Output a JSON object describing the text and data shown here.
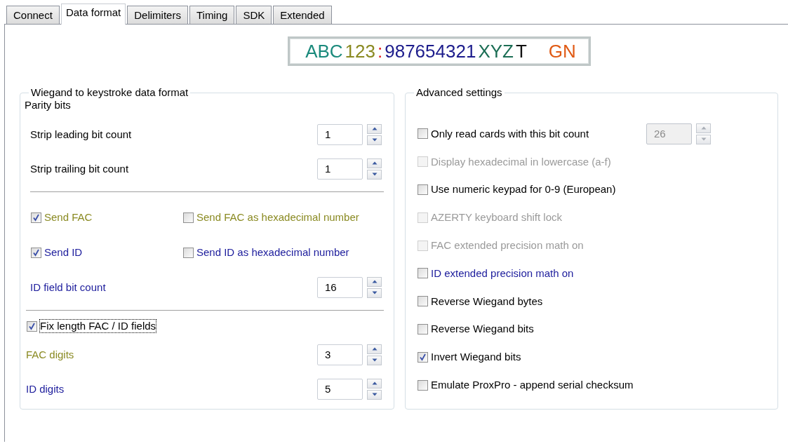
{
  "tabs": [
    {
      "label": "Connect",
      "selected": false
    },
    {
      "label": "Data format",
      "selected": true
    },
    {
      "label": "Delimiters",
      "selected": false
    },
    {
      "label": "Timing",
      "selected": false
    },
    {
      "label": "SDK",
      "selected": false
    },
    {
      "label": "Extended",
      "selected": false
    }
  ],
  "preview": {
    "segments": [
      {
        "text": "ABC",
        "color": "#1b8a7c"
      },
      {
        "text": "123",
        "color": "#8a8a22"
      },
      {
        "text": ":",
        "color": "#e01b1b"
      },
      {
        "text": "987654321",
        "color": "#1c1c8c"
      },
      {
        "text": "XYZ",
        "color": "#1c6e55"
      },
      {
        "text": "T",
        "color": "#111111"
      },
      {
        "text": "GN",
        "color": "#e05a14"
      }
    ]
  },
  "wiegand_group": {
    "title": "Wiegand to keystroke data format",
    "items": [
      {
        "kind": "label",
        "text": "Parity bits"
      },
      {
        "kind": "spin",
        "label": "Strip leading bit count",
        "value": "1",
        "color": "#000000"
      },
      {
        "kind": "spin",
        "label": "Strip trailing bit count",
        "value": "1",
        "color": "#000000"
      },
      {
        "kind": "separator"
      },
      {
        "kind": "pair",
        "checks": [
          {
            "label": "Send FAC",
            "checked": true,
            "disabled": false,
            "color": "#8a8a22"
          },
          {
            "label": "Send FAC as hexadecimal number",
            "checked": false,
            "disabled": false,
            "color": "#8a8a22"
          }
        ]
      },
      {
        "kind": "pair",
        "checks": [
          {
            "label": "Send ID",
            "checked": true,
            "disabled": false,
            "color": "#1c1c9c"
          },
          {
            "label": "Send ID as hexadecimal number",
            "checked": false,
            "disabled": false,
            "color": "#1c1c9c"
          }
        ]
      },
      {
        "kind": "spin",
        "label": "ID field bit count",
        "value": "16",
        "color": "#1c1c9c"
      },
      {
        "kind": "separator"
      },
      {
        "kind": "check",
        "label": "Fix length FAC / ID fields",
        "checked": true,
        "disabled": false,
        "focused": true,
        "color": "#000000"
      },
      {
        "kind": "spin",
        "label": "FAC digits",
        "value": "3",
        "color": "#8a8a22"
      },
      {
        "kind": "spin",
        "label": "ID digits",
        "value": "5",
        "color": "#1c1c9c"
      }
    ]
  },
  "advanced_group": {
    "title": "Advanced settings",
    "items": [
      {
        "kind": "check_spin",
        "label": "Only read cards with this bit count",
        "checked": false,
        "disabled": false,
        "color": "#000000",
        "value": "26",
        "spin_disabled": true
      },
      {
        "kind": "check",
        "label": "Display hexadecimal in lowercase (a-f)",
        "checked": false,
        "disabled": true
      },
      {
        "kind": "check",
        "label": "Use numeric keypad for 0-9 (European)",
        "checked": false,
        "disabled": false,
        "color": "#000000"
      },
      {
        "kind": "check",
        "label": "AZERTY keyboard shift lock",
        "checked": false,
        "disabled": true
      },
      {
        "kind": "check",
        "label": "FAC extended precision math on",
        "checked": false,
        "disabled": true
      },
      {
        "kind": "check",
        "label": "ID extended precision math on",
        "checked": false,
        "disabled": false,
        "color": "#1c1c9c"
      },
      {
        "kind": "check",
        "label": "Reverse Wiegand bytes",
        "checked": false,
        "disabled": false,
        "color": "#000000"
      },
      {
        "kind": "check",
        "label": "Reverse Wiegand bits",
        "checked": false,
        "disabled": false,
        "color": "#000000"
      },
      {
        "kind": "check",
        "label": "Invert Wiegand bits",
        "checked": true,
        "disabled": false,
        "color": "#000000"
      },
      {
        "kind": "check",
        "label": "Emulate ProxPro - append serial checksum",
        "checked": false,
        "disabled": false,
        "color": "#000000"
      }
    ]
  }
}
